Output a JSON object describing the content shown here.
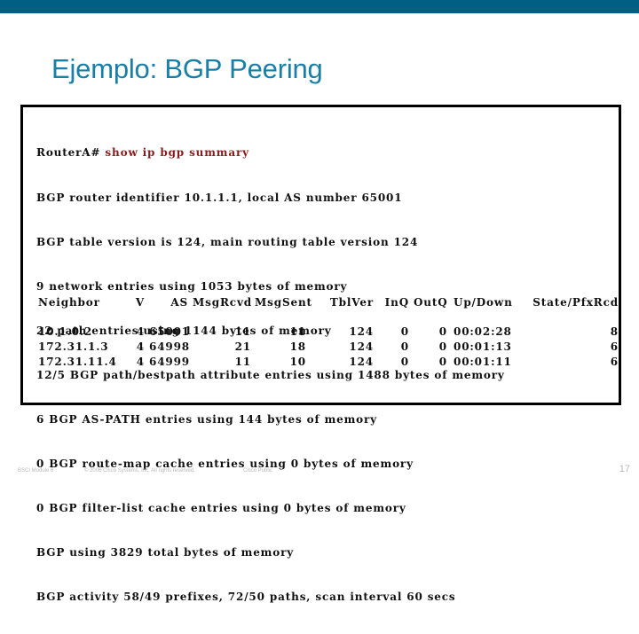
{
  "slide": {
    "title": "Ejemplo: BGP Peering",
    "colors": {
      "topbar": "#015f84",
      "title": "#1a7fa8",
      "command": "#8b1a1a"
    }
  },
  "terminal": {
    "prompt": "RouterA# ",
    "command": "show ip bgp summary",
    "lines": [
      "BGP router identifier 10.1.1.1, local AS number 65001",
      "BGP table version is 124, main routing table version 124",
      "9 network entries using 1053 bytes of memory",
      "22 path entries using 1144 bytes of memory",
      "12/5 BGP path/bestpath attribute entries using 1488 bytes of memory",
      "6 BGP AS-PATH entries using 144 bytes of memory",
      "0 BGP route-map cache entries using 0 bytes of memory",
      "0 BGP filter-list cache entries using 0 bytes of memory",
      "BGP using 3829 total bytes of memory",
      "BGP activity 58/49 prefixes, 72/50 paths, scan interval 60 secs"
    ],
    "table": {
      "headers": [
        "Neighbor",
        "V",
        "AS",
        "MsgRcvd",
        "MsgSent",
        "TblVer",
        "InQ",
        "OutQ",
        "Up/Down",
        "State/PfxRcd"
      ],
      "rows": [
        [
          "10.1.0.2",
          "4",
          "65001",
          "11",
          "11",
          "124",
          "0",
          "0",
          "00:02:28",
          "8"
        ],
        [
          "172.31.1.3",
          "4",
          "64998",
          "21",
          "18",
          "124",
          "0",
          "0",
          "00:01:13",
          "6"
        ],
        [
          "172.31.11.4",
          "4",
          "64999",
          "11",
          "10",
          "124",
          "0",
          "0",
          "00:01:11",
          "6"
        ]
      ]
    }
  },
  "footer": {
    "module": "BSCI Module 6",
    "copyright": "© 2006 Cisco Systems, Inc. All rights reserved.",
    "classification": "Cisco Public",
    "page_number": "17"
  }
}
